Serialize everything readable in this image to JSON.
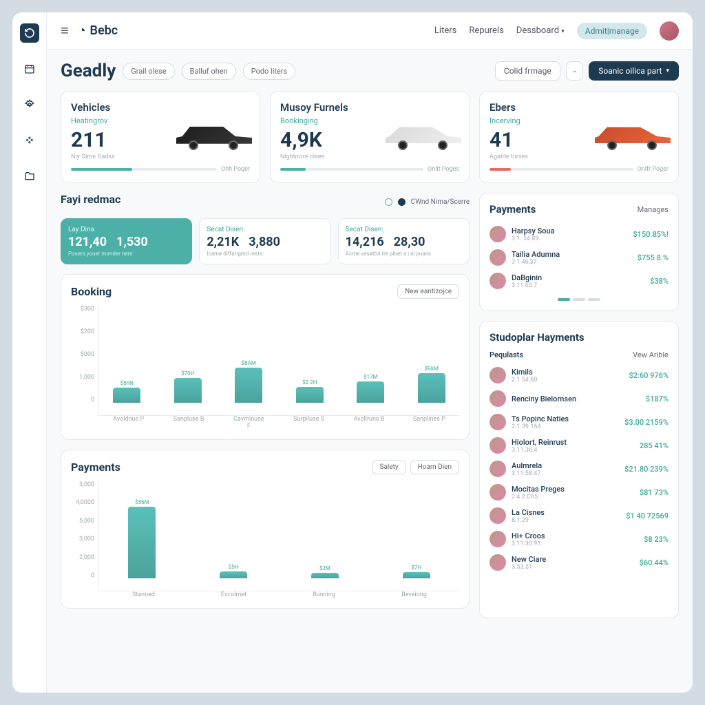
{
  "brand": "Bebc",
  "topnav": {
    "liters": "Liters",
    "repurs": "Repurels",
    "dashboard": "Dessboard",
    "admin": "Admit|manage"
  },
  "page": {
    "title": "Geadly"
  },
  "chips": {
    "c1": "Grail olese",
    "c2": "Balluf ohen",
    "c3": "Podo liters"
  },
  "headright": {
    "dropdown": "Colid frrnage",
    "primary": "Soanic oilica part"
  },
  "kpi": {
    "vehicles": {
      "title": "Vehicles",
      "sub": "Heatingrov",
      "val": "211",
      "note": "Niy Gime Gadss",
      "prog_label": "Onh Poger",
      "prog_pct": 42
    },
    "funnels": {
      "title": "Musoy Furnels",
      "sub": "Bookinging",
      "val": "4,9K",
      "note": "Nightrorre olsee",
      "prog_label": "Onlit Poges",
      "prog_pct": 18
    },
    "ebers": {
      "title": "Ebers",
      "sub": "Incerving",
      "val": "41",
      "note": "Agatite turses",
      "prog_label": "Onlfr Poger",
      "prog_pct": 15
    }
  },
  "fayi": {
    "title": "Fayi redmac",
    "radio_label": "CWnd Nima/Scerre"
  },
  "stats": {
    "s1": {
      "label": "Lay Dina",
      "v1": "121,40",
      "v2": "1,530",
      "foot": "Posers youer mımder nere"
    },
    "s2": {
      "label": "Secat Disen:",
      "v1": "2,21K",
      "v2": "3,880",
      "foot": "Icame diffarigmd rests:"
    },
    "s3": {
      "label": "Secat Disen:",
      "v1": "14,216",
      "v2": "28,30",
      "foot": "Acme vesattol tre ploet a ı el puass"
    }
  },
  "booking_chart": {
    "title": "Booking",
    "btn": "New eantizojce"
  },
  "payments_chart": {
    "title": "Payments",
    "btn1": "Salety",
    "btn2": "Hoam Dien"
  },
  "payments_panel": {
    "title": "Payments",
    "link": "Manages",
    "rows": [
      {
        "name": "Harpsy Soua",
        "meta": "3:1. 54.89",
        "amt": "$150.85%!"
      },
      {
        "name": "Tailia Adumna",
        "meta": "3 1 46,37",
        "amt": "$755 8.%"
      },
      {
        "name": "DaBginin",
        "meta": "3:11 65.7",
        "amt": "$38%"
      }
    ]
  },
  "studoplar": {
    "title": "Studoplar Hayments",
    "col1": "Pequlasts",
    "col2": "Vew Arible",
    "rows": [
      {
        "name": "Kimils",
        "meta": "2.1 54.60",
        "amt": "$2:60 976%"
      },
      {
        "name": "Renciny Bielornsen",
        "meta": "",
        "amt": "$187%"
      },
      {
        "name": "Ts Popinc Naties",
        "meta": "2.1.39.164",
        "amt": "$3.00 2159%"
      },
      {
        "name": "Hiolort, Reinrust",
        "meta": "3.11.36.4",
        "amt": "285 41%"
      },
      {
        "name": "Aulmrela",
        "meta": "3 11.58.47",
        "amt": "$21.80 239%"
      },
      {
        "name": "Mocitas Preges",
        "meta": "2 4.2.C65",
        "amt": "$81 73%"
      },
      {
        "name": "La Cisnes",
        "meta": "8.1.29",
        "amt": "$1 40 72569"
      },
      {
        "name": "Hi+ Croos",
        "meta": "3 11.30.91",
        "amt": "$8 23%"
      },
      {
        "name": "New Ciare",
        "meta": "3.53.51",
        "amt": "$60.44%"
      }
    ]
  },
  "chart_data": [
    {
      "type": "bar",
      "title": "Booking",
      "categories": [
        "Avoldnue P",
        "Sanpluse B",
        "Cavminuse F",
        "Surpiluse S",
        "Avollruns B",
        "Sanplines P"
      ],
      "labels": [
        "$5hN",
        "$70H",
        "$8AM",
        "$2.2H",
        "$17M",
        "$FAM"
      ],
      "values": [
        50,
        82,
        118,
        52,
        72,
        100
      ],
      "ylim": [
        0,
        300
      ],
      "yticks_raw": [
        "$300",
        "$200",
        "$000",
        "1,000",
        "0"
      ]
    },
    {
      "type": "bar",
      "title": "Payments",
      "categories": [
        "Stanned",
        "Excolmet",
        "Bunning",
        "Beveiong"
      ],
      "labels": [
        "$56M",
        "$5H",
        "$2M",
        "$7H"
      ],
      "values": [
        4000,
        400,
        300,
        350
      ],
      "ylim": [
        0,
        5000
      ],
      "yticks_raw": [
        "3,000",
        "4,0000",
        "5,000",
        "3,000",
        "2,000",
        "0"
      ]
    }
  ]
}
